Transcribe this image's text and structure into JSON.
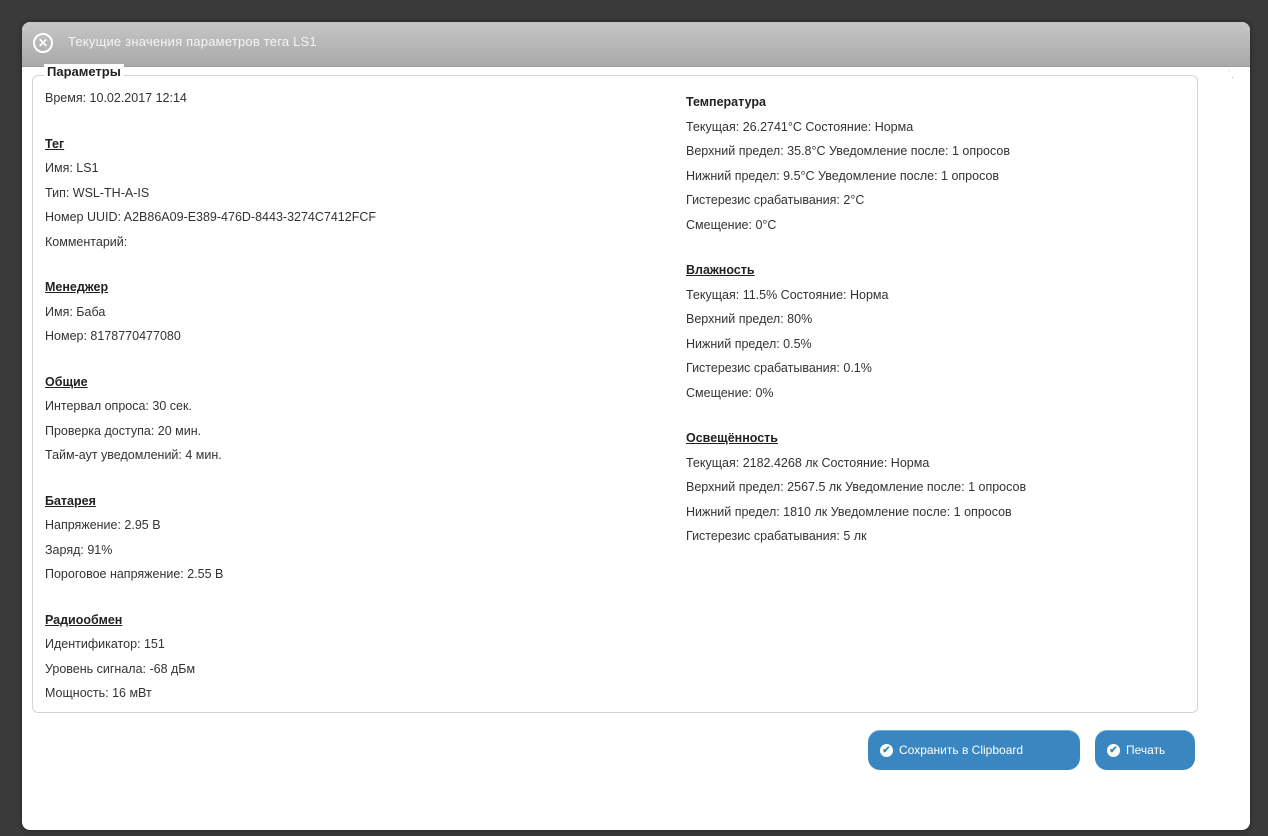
{
  "dialog": {
    "title": "Текущие значения параметров тега LS1",
    "close_icon": "close-circle-icon"
  },
  "panel": {
    "legend": "Параметры",
    "corner_mark": "˙."
  },
  "left": {
    "time": "Время: 10.02.2017 12:14",
    "tag": {
      "heading": "Тег",
      "lines": [
        "Имя: LS1",
        "Тип: WSL-TH-A-IS",
        "Номер UUID: A2B86A09-E389-476D-8443-3274C7412FCF",
        "Комментарий:"
      ]
    },
    "manager": {
      "heading": "Менеджер",
      "lines": [
        "Имя: Баба",
        "Номер: 8178770477080"
      ]
    },
    "general": {
      "heading": "Общие",
      "lines": [
        "Интервал опроса: 30 сек.",
        "Проверка доступа: 20 мин.",
        "Тайм-аут уведомлений: 4 мин."
      ]
    },
    "battery": {
      "heading": "Батарея",
      "lines": [
        "Напряжение: 2.95 В",
        "Заряд: 91%",
        "Пороговое напряжение: 2.55 В"
      ]
    },
    "radio": {
      "heading": "Радиообмен",
      "lines": [
        "Идентификатор: 151",
        "Уровень сигнала: -68 дБм",
        "Мощность: 16 мВт"
      ]
    }
  },
  "right": {
    "temperature": {
      "heading": "Температура",
      "lines": [
        "Текущая: 26.2741°C    Состояние: Норма",
        "Верхний предел: 35.8°C    Уведомление после: 1 опросов",
        "Нижний предел: 9.5°C    Уведомление после: 1 опросов",
        "Гистерезис срабатывания: 2°C",
        "Смещение: 0°C"
      ]
    },
    "humidity": {
      "heading": "Влажность",
      "lines": [
        "Текущая: 11.5%    Состояние: Норма",
        "Верхний предел: 80%",
        "Нижний предел: 0.5%",
        "Гистерезис срабатывания: 0.1%",
        "Смещение: 0%"
      ]
    },
    "light": {
      "heading": "Освещённость",
      "lines": [
        "Текущая: 2182.4268 лк    Состояние: Норма",
        "Верхний предел: 2567.5 лк    Уведомление после: 1 опросов",
        "Нижний предел: 1810 лк    Уведомление после: 1 опросов",
        "Гистерезис срабатывания: 5 лк"
      ]
    }
  },
  "buttons": {
    "clipboard": "Сохранить в Clipboard",
    "print": "Печать",
    "check_icon": "check-circle-icon"
  },
  "colors": {
    "titlebar": "#b4b4b4",
    "button": "#3a86c0",
    "backdrop": "#3a3a3a"
  }
}
